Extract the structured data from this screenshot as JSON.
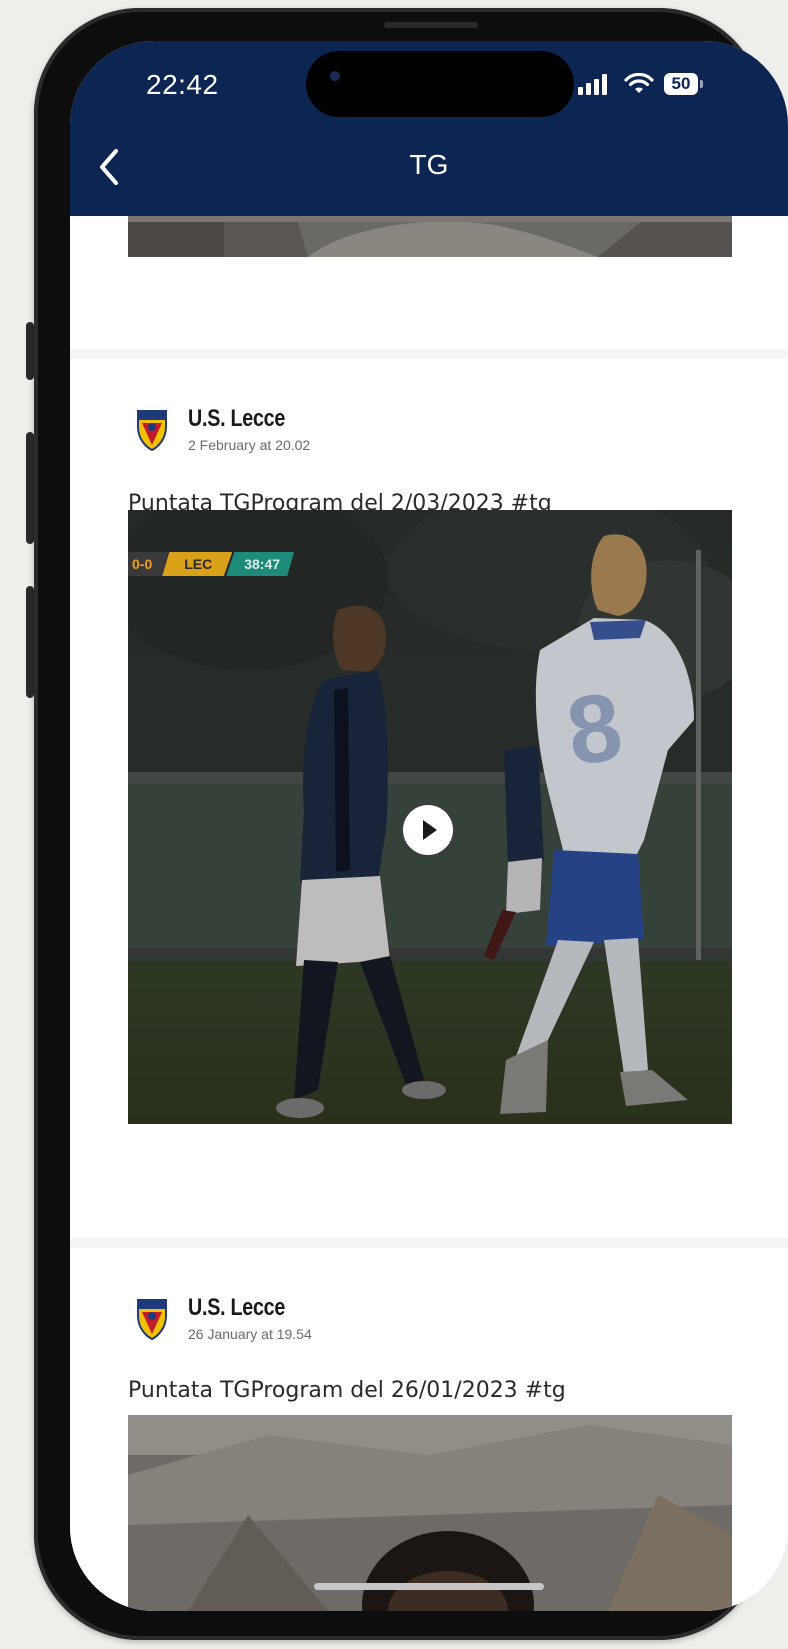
{
  "status_bar": {
    "time": "22:42",
    "battery": "50",
    "signal_icon": "signal-bars-icon",
    "wifi_icon": "wifi-icon",
    "battery_icon": "battery-icon"
  },
  "nav": {
    "title": "TG",
    "back_icon": "chevron-left-icon"
  },
  "posts": [
    {
      "author": "U.S. Lecce",
      "date": "2 February at 20.02",
      "caption": "Puntata TGProgram del 2/03/2023 #tg",
      "media_type": "video",
      "scoreboard": {
        "score": "0-0",
        "team": "LEC",
        "clock": "38:47"
      },
      "play_icon": "play-icon"
    },
    {
      "author": "U.S. Lecce",
      "date": "26 January at 19.54",
      "caption": "Puntata TGProgram del 26/01/2023 #tg",
      "media_type": "video"
    }
  ],
  "colors": {
    "header_bg": "#0c2553",
    "background": "#efeeea",
    "separator": "#f4f4f4"
  }
}
